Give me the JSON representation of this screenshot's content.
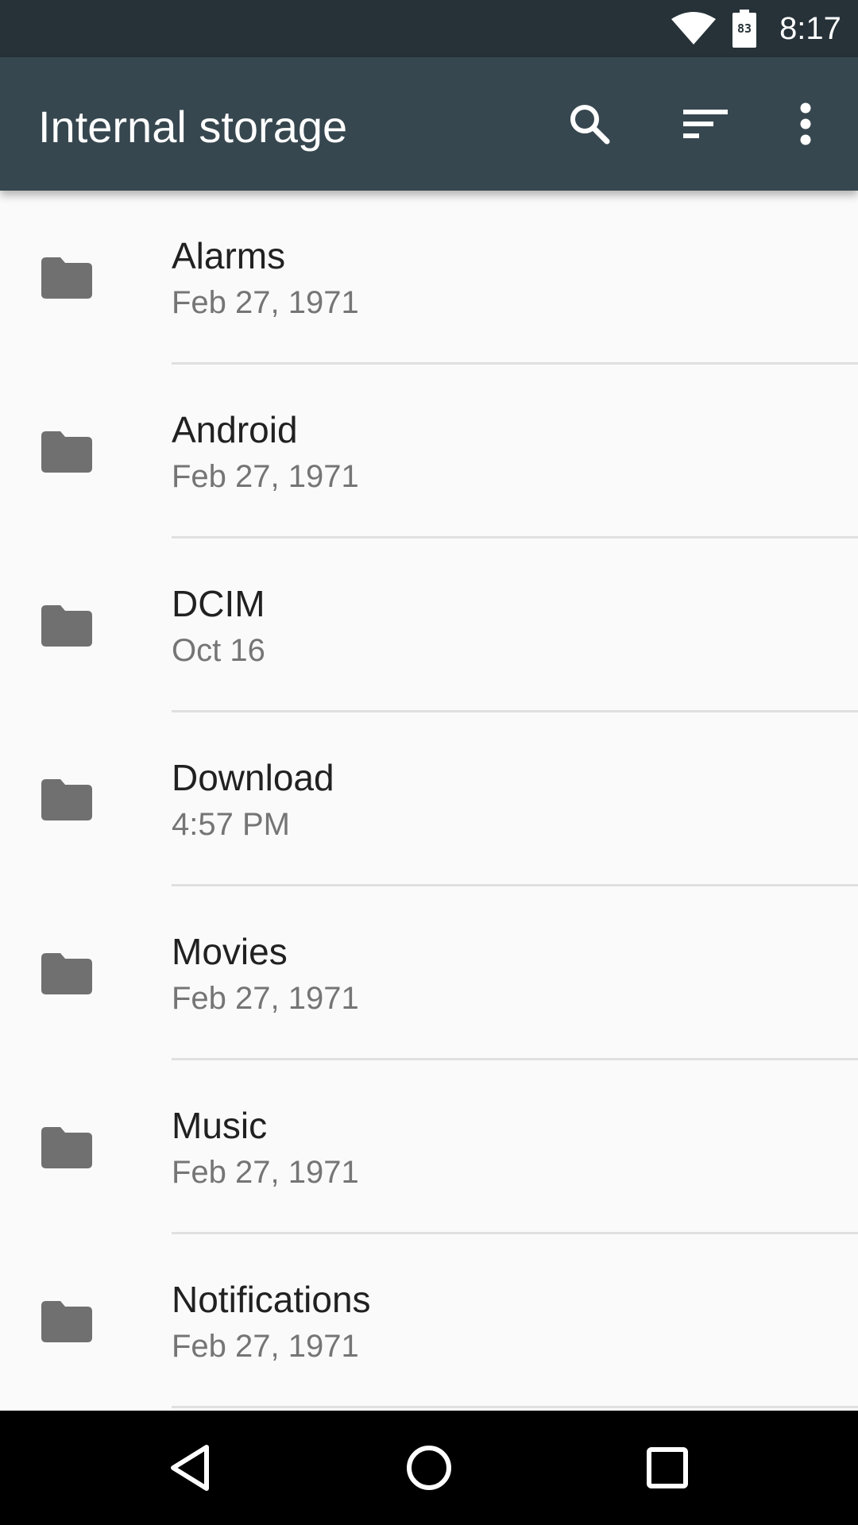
{
  "status_bar": {
    "time": "8:17",
    "battery_level": "83",
    "wifi_icon": "wifi-icon",
    "battery_icon": "battery-icon"
  },
  "app_bar": {
    "title": "Internal storage",
    "background_color": "#37474f",
    "actions": [
      {
        "icon": "search-icon"
      },
      {
        "icon": "sort-icon"
      },
      {
        "icon": "more-vert-icon"
      }
    ]
  },
  "files": [
    {
      "name": "Alarms",
      "date": "Feb 27, 1971",
      "icon": "folder-icon"
    },
    {
      "name": "Android",
      "date": "Feb 27, 1971",
      "icon": "folder-icon"
    },
    {
      "name": "DCIM",
      "date": "Oct 16",
      "icon": "folder-icon"
    },
    {
      "name": "Download",
      "date": "4:57 PM",
      "icon": "folder-icon"
    },
    {
      "name": "Movies",
      "date": "Feb 27, 1971",
      "icon": "folder-icon"
    },
    {
      "name": "Music",
      "date": "Feb 27, 1971",
      "icon": "folder-icon"
    },
    {
      "name": "Notifications",
      "date": "Feb 27, 1971",
      "icon": "folder-icon"
    }
  ],
  "nav_bar": {
    "buttons": [
      {
        "icon": "back-icon"
      },
      {
        "icon": "home-icon"
      },
      {
        "icon": "recents-icon"
      }
    ]
  },
  "colors": {
    "status_bar": "#263238",
    "app_bar": "#37474f",
    "folder_icon": "#707070",
    "background": "#fafafa"
  }
}
